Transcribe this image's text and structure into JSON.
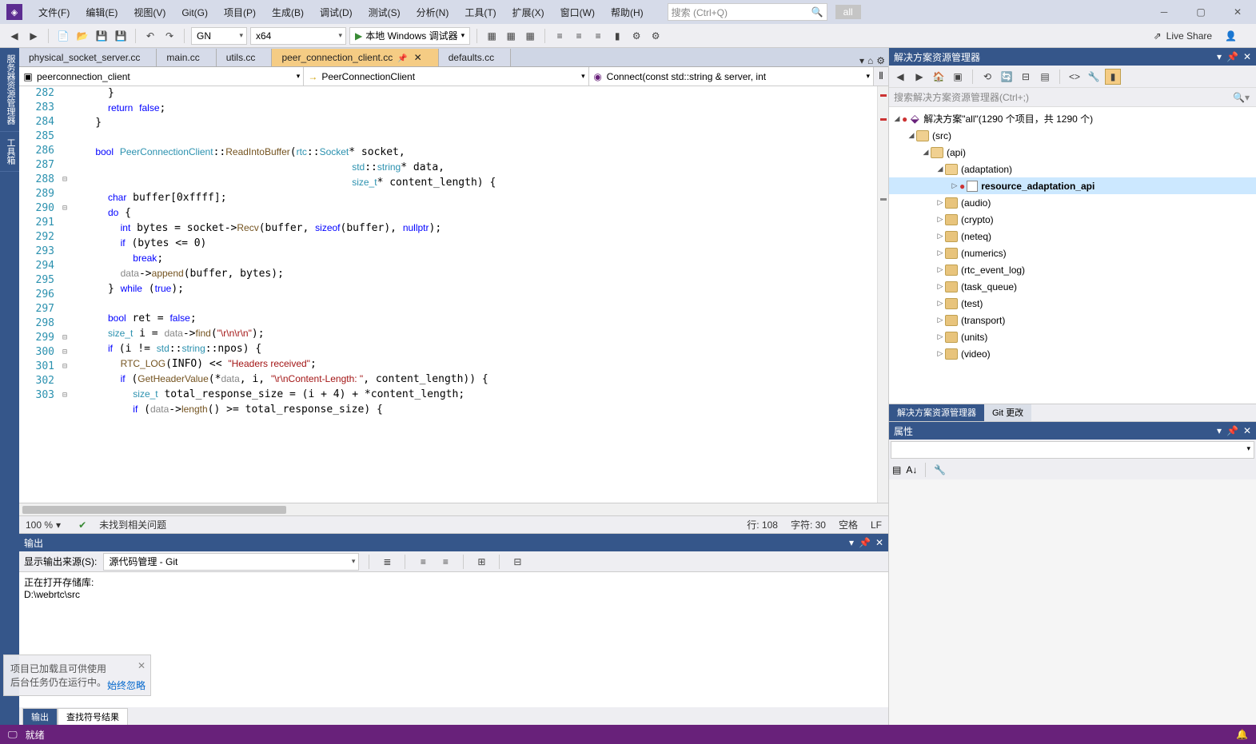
{
  "menu": [
    "文件(F)",
    "编辑(E)",
    "视图(V)",
    "Git(G)",
    "项目(P)",
    "生成(B)",
    "调试(D)",
    "测试(S)",
    "分析(N)",
    "工具(T)",
    "扩展(X)",
    "窗口(W)",
    "帮助(H)"
  ],
  "search": {
    "placeholder": "搜索 (Ctrl+Q)"
  },
  "allBtn": "all",
  "toolbar": {
    "config": "GN",
    "platform": "x64",
    "debug": "本地 Windows 调试器",
    "liveShare": "Live Share"
  },
  "leftTabs": [
    "服务器资源管理器",
    "工具箱"
  ],
  "docTabs": [
    {
      "label": "physical_socket_server.cc",
      "active": false
    },
    {
      "label": "main.cc",
      "active": false
    },
    {
      "label": "utils.cc",
      "active": false
    },
    {
      "label": "peer_connection_client.cc",
      "active": true,
      "pinned": true
    },
    {
      "label": "defaults.cc",
      "active": false
    }
  ],
  "navBar": {
    "project": "peerconnection_client",
    "class": "PeerConnectionClient",
    "member": "Connect(const std::string & server, int"
  },
  "lineStart": 282,
  "foldMarks": {
    "288": "⊟",
    "290": "⊟",
    "299": "⊟",
    "300": "⊟",
    "301": "⊟",
    "303": "⊟"
  },
  "statusLine": {
    "zoom": "100 %",
    "issues": "未找到相关问题",
    "line": "行: 108",
    "col": "字符: 30",
    "ins": "空格",
    "enc": "LF"
  },
  "outputPanel": {
    "title": "输出",
    "fromLabel": "显示输出来源(S):",
    "source": "源代码管理 - Git",
    "body": [
      "正在打开存储库:",
      "D:\\webrtc\\src"
    ]
  },
  "bottomTabs": [
    {
      "label": "输出",
      "active": true
    },
    {
      "label": "查找符号结果",
      "active": false
    }
  ],
  "solutionExplorer": {
    "title": "解决方案资源管理器",
    "searchPlaceholder": "搜索解决方案资源管理器(Ctrl+;)",
    "solution": "解决方案\"all\"(1290 个项目，共 1290 个)",
    "tabs": [
      {
        "label": "解决方案资源管理器",
        "active": true
      },
      {
        "label": "Git 更改",
        "active": false
      }
    ]
  },
  "tree": [
    {
      "depth": 0,
      "exp": "open",
      "icon": "sln",
      "label": "解决方案\"all\"(1290 个项目，共 1290 个)",
      "status": "●"
    },
    {
      "depth": 1,
      "exp": "open",
      "icon": "folder-open",
      "label": "(src)"
    },
    {
      "depth": 2,
      "exp": "open",
      "icon": "folder-open",
      "label": "(api)"
    },
    {
      "depth": 3,
      "exp": "open",
      "icon": "folder-open",
      "label": "(adaptation)"
    },
    {
      "depth": 4,
      "exp": "closed",
      "icon": "proj",
      "label": "resource_adaptation_api",
      "bold": true,
      "status": "●"
    },
    {
      "depth": 3,
      "exp": "closed",
      "icon": "folder",
      "label": "(audio)"
    },
    {
      "depth": 3,
      "exp": "closed",
      "icon": "folder",
      "label": "(crypto)"
    },
    {
      "depth": 3,
      "exp": "closed",
      "icon": "folder",
      "label": "(neteq)"
    },
    {
      "depth": 3,
      "exp": "closed",
      "icon": "folder",
      "label": "(numerics)"
    },
    {
      "depth": 3,
      "exp": "closed",
      "icon": "folder",
      "label": "(rtc_event_log)"
    },
    {
      "depth": 3,
      "exp": "closed",
      "icon": "folder",
      "label": "(task_queue)"
    },
    {
      "depth": 3,
      "exp": "closed",
      "icon": "folder",
      "label": "(test)"
    },
    {
      "depth": 3,
      "exp": "closed",
      "icon": "folder",
      "label": "(transport)"
    },
    {
      "depth": 3,
      "exp": "closed",
      "icon": "folder",
      "label": "(units)"
    },
    {
      "depth": 3,
      "exp": "closed",
      "icon": "folder",
      "label": "(video)"
    }
  ],
  "props": {
    "title": "属性"
  },
  "statusbar": {
    "ready": "就绪"
  },
  "notif": {
    "line1": "项目已加载且可供使用",
    "line2": "后台任务仍在运行中。",
    "link": "始终忽略"
  }
}
